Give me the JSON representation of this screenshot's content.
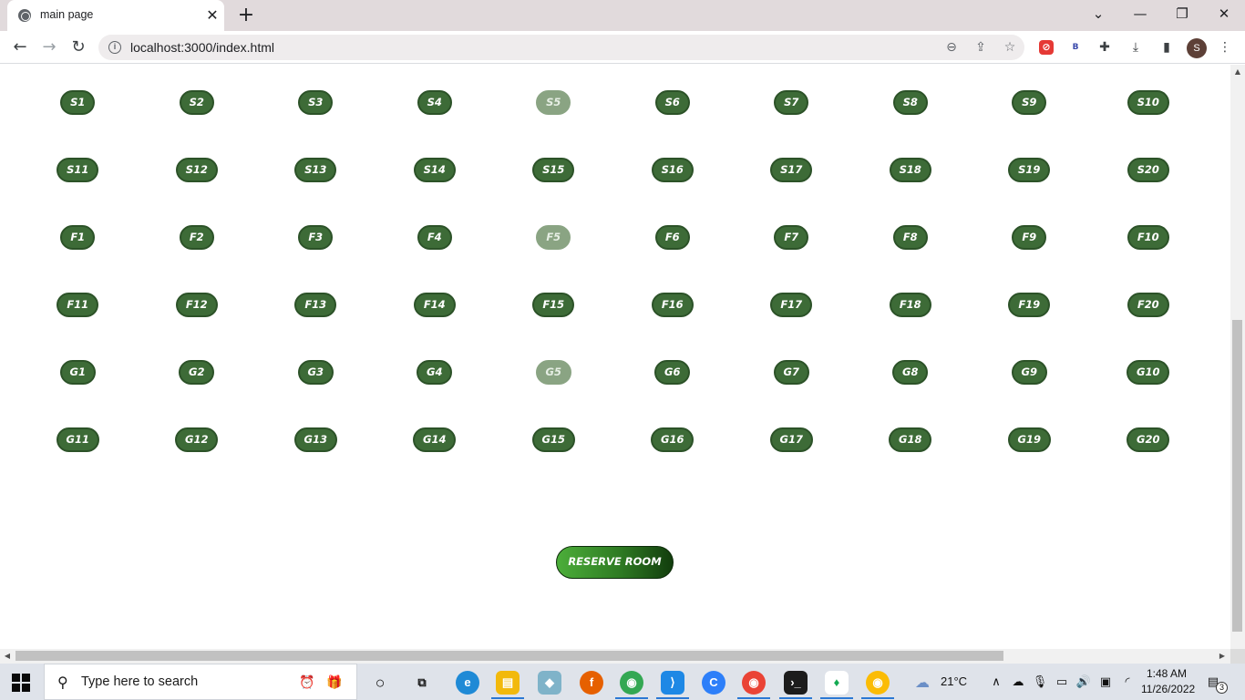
{
  "browser": {
    "tab_title": "main page",
    "tab_close": "✕",
    "new_tab": "+",
    "url": "localhost:3000/index.html",
    "profile_initial": "S",
    "window_controls": {
      "minimize": "—",
      "restore": "❐",
      "close": "✕",
      "tab_search": "⌄"
    }
  },
  "seats": [
    [
      "S1",
      "S2",
      "S3",
      "S4",
      "S5",
      "S6",
      "S7",
      "S8",
      "S9",
      "S10"
    ],
    [
      "S11",
      "S12",
      "S13",
      "S14",
      "S15",
      "S16",
      "S17",
      "S18",
      "S19",
      "S20"
    ],
    [
      "F1",
      "F2",
      "F3",
      "F4",
      "F5",
      "F6",
      "F7",
      "F8",
      "F9",
      "F10"
    ],
    [
      "F11",
      "F12",
      "F13",
      "F14",
      "F15",
      "F16",
      "F17",
      "F18",
      "F19",
      "F20"
    ],
    [
      "G1",
      "G2",
      "G3",
      "G4",
      "G5",
      "G6",
      "G7",
      "G8",
      "G9",
      "G10"
    ],
    [
      "G11",
      "G12",
      "G13",
      "G14",
      "G15",
      "G16",
      "G17",
      "G18",
      "G19",
      "G20"
    ]
  ],
  "disabled_seats": [
    "S5",
    "F5",
    "G5"
  ],
  "colors": {
    "seat": "#3d6b37",
    "seat_disabled": "#8aa483",
    "button_start": "#4cae3a",
    "button_end": "#123d0d"
  },
  "reserve_button": "RESERVE ROOM",
  "taskbar": {
    "search_placeholder": "Type here to search",
    "weather": "21°C",
    "time": "1:48 AM",
    "date": "11/26/2022",
    "notification_count": "3"
  }
}
